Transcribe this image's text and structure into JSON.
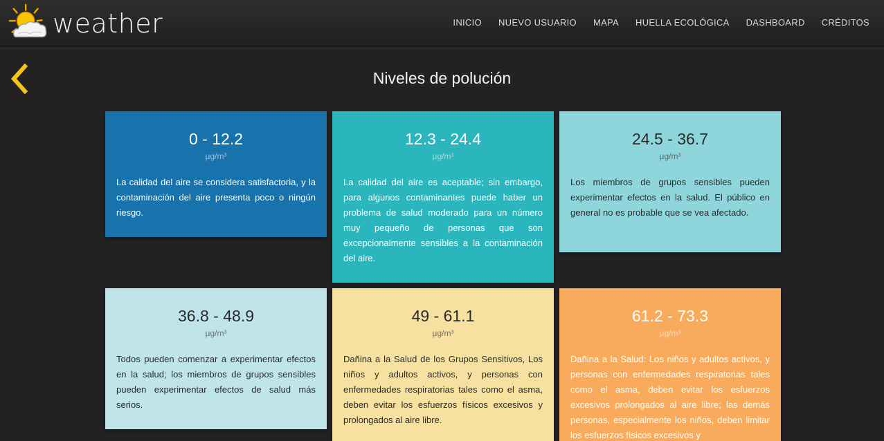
{
  "brand": {
    "name": "weather",
    "logo_icon": "sun-cloud-icon"
  },
  "nav": {
    "items": [
      {
        "label": "INICIO"
      },
      {
        "label": "NUEVO USUARIO"
      },
      {
        "label": "MAPA"
      },
      {
        "label": "HUELLA ECOLÓGICA"
      },
      {
        "label": "DASHBOARD"
      },
      {
        "label": "CRÉDITOS"
      }
    ]
  },
  "back": {
    "icon": "chevron-left-icon",
    "color": "#f5c518"
  },
  "page": {
    "title": "Niveles de polución"
  },
  "levels": [
    {
      "range": "0 - 12.2",
      "unit": "µg/m³",
      "color": "#1872ab",
      "description": "La calidad del aire se considera satisfactoria, y la contaminación del aire presenta poco o ningún riesgo."
    },
    {
      "range": "12.3 - 24.4",
      "unit": "µg/m³",
      "color": "#2bb5bd",
      "description": "La calidad del aire es aceptable; sin embargo, para algunos contaminantes puede haber un problema de salud moderado para un número muy pequeño de personas que son excepcionalmente sensibles a la contaminación del aire."
    },
    {
      "range": "24.5 - 36.7",
      "unit": "µg/m³",
      "color": "#8fd6dc",
      "description": "Los miembros de grupos sensibles pueden experimentar efectos en la salud. El público en general no es probable que se vea afectado."
    },
    {
      "range": "36.8 - 48.9",
      "unit": "µg/m³",
      "color": "#bfe5eb",
      "description": "Todos pueden comenzar a experimentar efectos en la salud; los miembros de grupos sensibles pueden experimentar efectos de salud más serios."
    },
    {
      "range": "49 - 61.1",
      "unit": "µg/m³",
      "color": "#f7e1a0",
      "description": "Dañina a la Salud de los Grupos Sensitivos, Los niños y adultos activos, y personas con enfermedades respiratorias tales como el asma, deben evitar los esfuerzos físicos excesivos y prolongados al aire libre."
    },
    {
      "range": "61.2 - 73.3",
      "unit": "µg/m³",
      "color": "#f8ab5c",
      "description": "Dañina a la Salud: Los niños y adultos activos, y personas con enfermedades respiratorias tales como el asma, deben evitar los esfuerzos excesivos prolongados al aire libre; las demás personas, especialmente los niños, deben limitar los esfuerzos físicos excesivos y"
    }
  ]
}
